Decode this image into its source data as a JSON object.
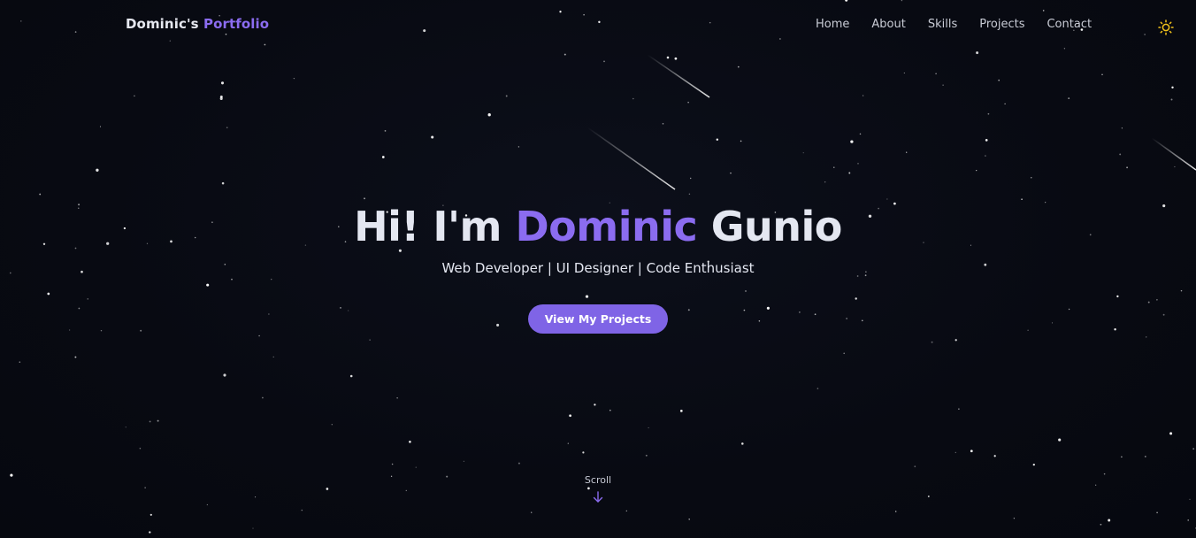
{
  "brand": {
    "name": "Dominic's",
    "accent": "Portfolio"
  },
  "nav": {
    "links": [
      "Home",
      "About",
      "Skills",
      "Projects",
      "Contact"
    ]
  },
  "theme_toggle": {
    "icon": "sun-icon"
  },
  "hero": {
    "greeting": "Hi! I'm",
    "first_name": "Dominic",
    "last_name": "Gunio",
    "subtitle": "Web Developer | UI Designer | Code Enthusiast",
    "cta_label": "View My Projects"
  },
  "scroll": {
    "label": "Scroll",
    "icon": "arrow-down-icon"
  },
  "colors": {
    "accent": "#8b6cf0",
    "button": "#7f64e6",
    "background": "#080a12",
    "text": "#e4e7f1",
    "sun": "#f2c21a"
  }
}
